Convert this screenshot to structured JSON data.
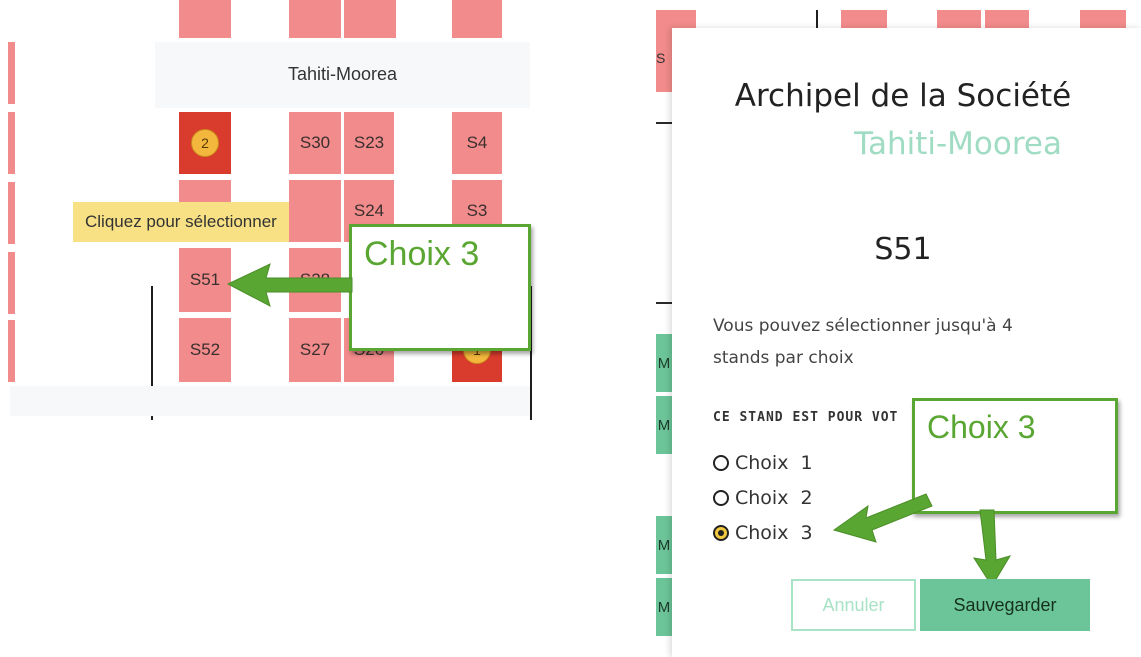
{
  "map": {
    "zone_label": "Tahiti-Moorea",
    "tooltip": "Cliquez pour sélectionner",
    "stands": {
      "s30": "S30",
      "s23": "S23",
      "s4": "S4",
      "s24": "S24",
      "s3": "S3",
      "s51": "S51",
      "s28": "S28",
      "s52": "S52",
      "s27": "S27",
      "s26": "S26"
    },
    "badges": {
      "stand_choice_2": "2",
      "stand_choice_1": "1"
    },
    "callout": "Choix 3"
  },
  "modal": {
    "title": "Archipel de la Société",
    "subtitle": "Tahiti-Moorea",
    "stand_code": "S51",
    "description_line1": "Vous pouvez sélectionner jusqu'à 4",
    "description_line2": "stands par choix",
    "question_label": "CE STAND EST POUR VOT",
    "options": [
      {
        "label": "Choix",
        "number": "1"
      },
      {
        "label": "Choix",
        "number": "2"
      },
      {
        "label": "Choix",
        "number": "3"
      }
    ],
    "selected_option": 3,
    "callout": "Choix 3",
    "cancel_label": "Annuler",
    "save_label": "Sauvegarder",
    "bg_left_letters": {
      "s": "S",
      "m1": "M",
      "m2": "M",
      "m3": "M",
      "m4": "M"
    }
  },
  "colors": {
    "stand": "#f28b8b",
    "stand_selected": "#d93b2c",
    "accent": "#6cc598",
    "callout_green": "#5aa632",
    "subtitle": "#9fdcc3"
  }
}
